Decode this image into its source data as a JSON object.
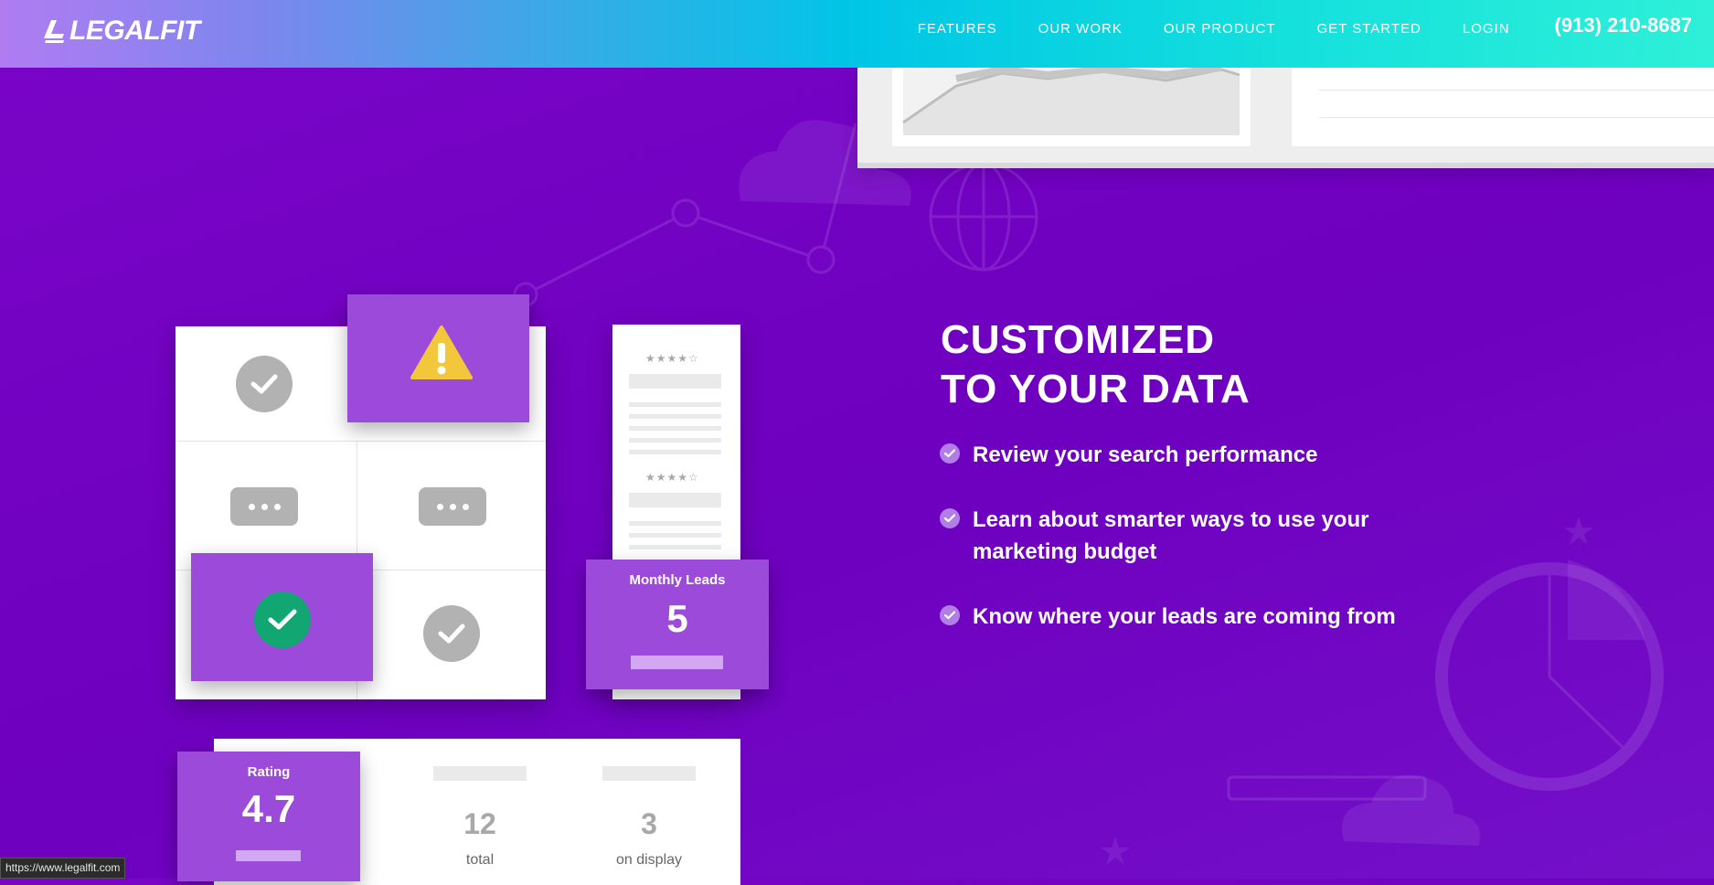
{
  "header": {
    "logo": "LEGALFIT",
    "nav": [
      "FEATURES",
      "OUR WORK",
      "OUR PRODUCT",
      "GET STARTED",
      "LOGIN"
    ],
    "phone": "(913) 210-8687"
  },
  "hero": {
    "heading_line1": "CUSTOMIZED",
    "heading_line2": "TO YOUR DATA",
    "features": [
      "Review your search performance",
      "Learn about smarter ways to use your marketing budget",
      "Know where your leads are coming from"
    ]
  },
  "illustration": {
    "monthly_leads_label": "Monthly Leads",
    "monthly_leads_value": "5",
    "rating_label": "Rating",
    "rating_value": "4.7",
    "total_value": "12",
    "total_caption": "total",
    "on_display_value": "3",
    "on_display_caption": "on display",
    "review_stars": "★★★★☆"
  },
  "status_bar": {
    "url": "https://www.legalfit.com"
  },
  "colors": {
    "background": "#7008c4",
    "tile": "#9b4ad9",
    "success": "#12a672",
    "warning": "#f3c73c"
  }
}
